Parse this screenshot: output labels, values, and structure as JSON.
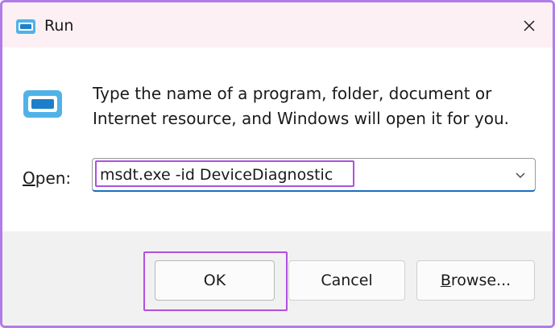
{
  "window": {
    "title": "Run",
    "icon": "run-icon",
    "close_icon": "close-icon"
  },
  "content": {
    "description": "Type the name of a program, folder, document or Internet resource, and Windows will open it for you.",
    "open_label_access": "O",
    "open_label_rest": "pen:",
    "input_value": "msdt.exe -id DeviceDiagnostic",
    "dropdown_icon": "chevron-down-icon"
  },
  "buttons": {
    "ok": "OK",
    "cancel": "Cancel",
    "browse_access": "B",
    "browse_rest": "rowse..."
  },
  "colors": {
    "accent": "#1a6fc0",
    "highlight": "#b050e0",
    "titlebar": "#fdf0f4",
    "footer": "#f2f1f2"
  }
}
